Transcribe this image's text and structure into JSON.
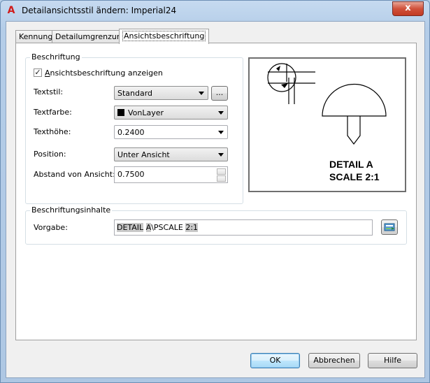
{
  "window": {
    "title": "Detailansichtsstil ändern: Imperial24",
    "app_icon": "autocad-a-icon",
    "close_label": "x"
  },
  "tabs": [
    {
      "label": "Kennung",
      "active": false
    },
    {
      "label": "Detailumgrenzung",
      "active": false
    },
    {
      "label": "Ansichtsbeschriftung",
      "active": true
    }
  ],
  "beschriftung": {
    "group_title": "Beschriftung",
    "show_label": "Ansichtsbeschriftung anzeigen",
    "show_checked": true,
    "textstil_label": "Textstil:",
    "textstil_value": "Standard",
    "textstil_more": "...",
    "textfarbe_label": "Textfarbe:",
    "textfarbe_value": "VonLayer",
    "textfarbe_swatch": "#000000",
    "texthoehe_label": "Texthöhe:",
    "texthoehe_value": "0.2400",
    "position_label": "Position:",
    "position_value": "Unter Ansicht",
    "abstand_label": "Abstand von Ansicht:",
    "abstand_value": "0.7500"
  },
  "preview": {
    "line1": "DETAIL A",
    "line2": "SCALE 2:1"
  },
  "inhalte": {
    "group_title": "Beschriftungsinhalte",
    "vorgabe_label": "Vorgabe:",
    "vorgabe_parts": [
      "DETAIL",
      " ",
      "A",
      "\\PSCALE ",
      "2:1"
    ],
    "field_button_icon": "insert-field-icon"
  },
  "buttons": {
    "ok": "OK",
    "cancel": "Abbrechen",
    "help": "Hilfe"
  }
}
